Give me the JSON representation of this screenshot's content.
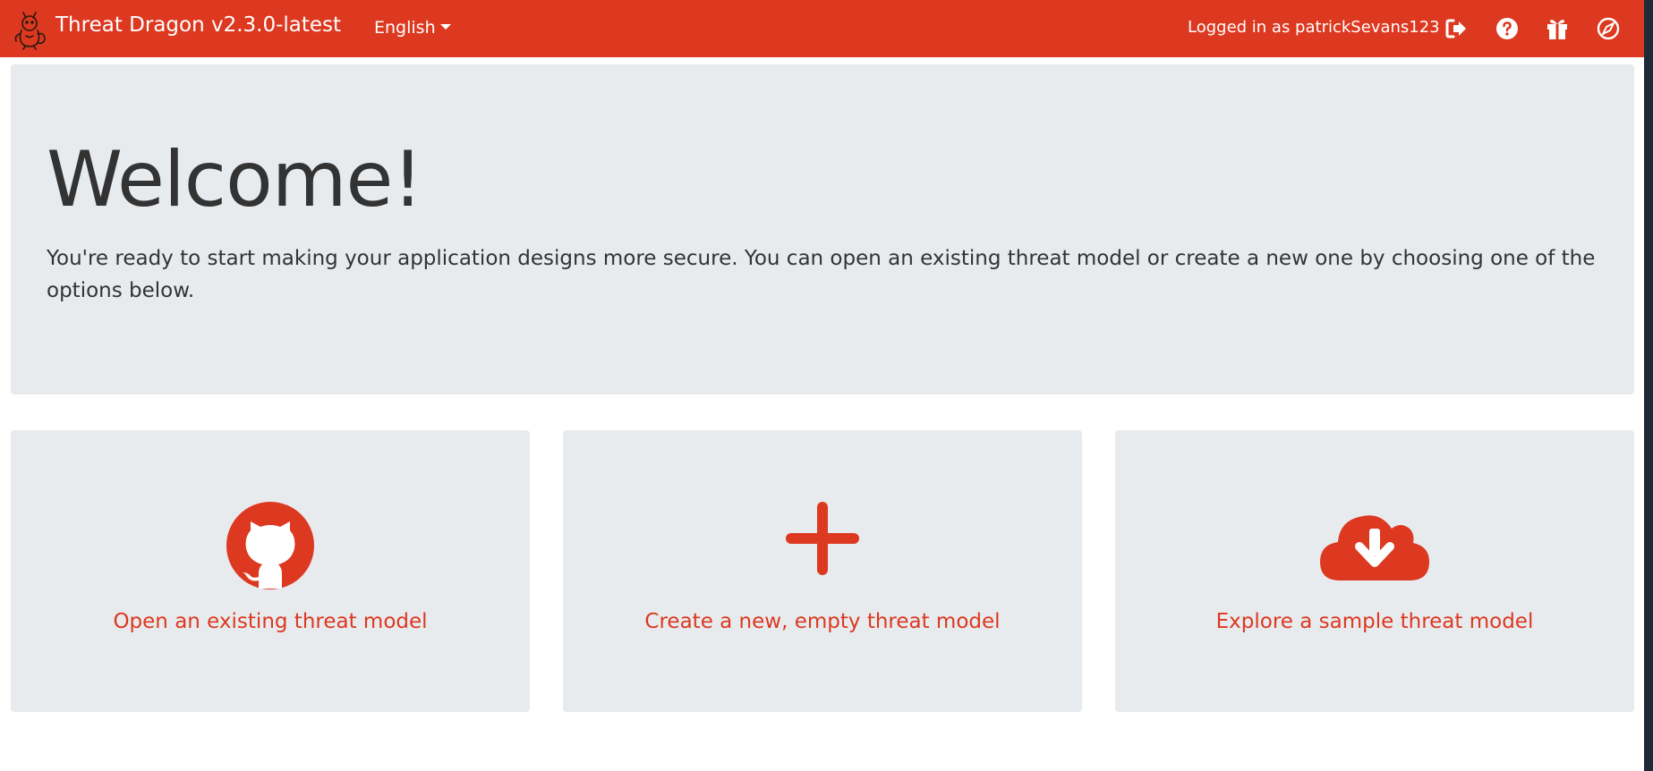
{
  "navbar": {
    "brand_title": "Threat Dragon v2.3.0-latest",
    "language": "English",
    "logged_in_text": "Logged in as patrickSevans123",
    "background_color": "#dd3820",
    "icons": [
      "logout-icon",
      "help-icon",
      "gift-icon",
      "compass-icon"
    ]
  },
  "welcome": {
    "title": "Welcome!",
    "text": "You're ready to start making your application designs more secure. You can open an existing threat model or create a new one by choosing one of the options below."
  },
  "cards": [
    {
      "icon": "github-icon",
      "label": "Open an existing threat model"
    },
    {
      "icon": "plus-icon",
      "label": "Create a new, empty threat model"
    },
    {
      "icon": "cloud-download-icon",
      "label": "Explore a sample threat model"
    }
  ],
  "colors": {
    "accent": "#dd3820",
    "panel": "#e8ebee",
    "text": "#333333"
  }
}
